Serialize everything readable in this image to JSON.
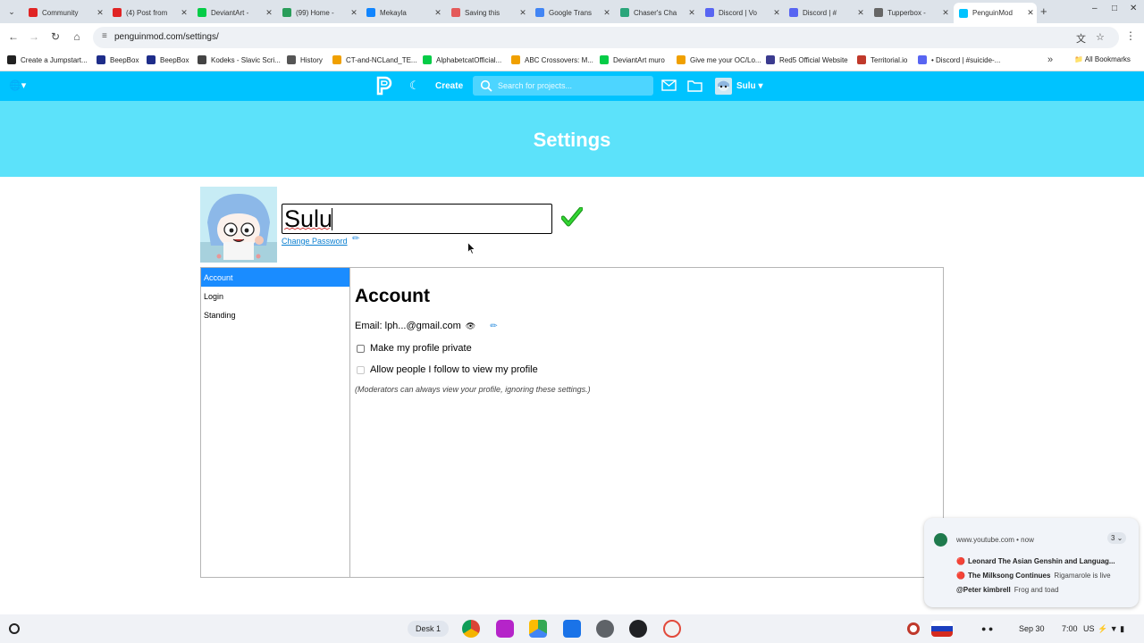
{
  "browser": {
    "tabs": [
      {
        "label": "Community",
        "color": "#e02424"
      },
      {
        "label": "(4) Post from",
        "color": "#e02424"
      },
      {
        "label": "DeviantArt -",
        "color": "#05cc47"
      },
      {
        "label": "(99) Home -",
        "color": "#2a9d5a"
      },
      {
        "label": "Mekayla",
        "color": "#1185fe"
      },
      {
        "label": "Saving this",
        "color": "#e45a5a"
      },
      {
        "label": "Google Trans",
        "color": "#4285f4"
      },
      {
        "label": "Chaser's Cha",
        "color": "#2aa57a"
      },
      {
        "label": "Discord | Vo",
        "color": "#5865f2"
      },
      {
        "label": "Discord | #",
        "color": "#5865f2"
      },
      {
        "label": "Tupperbox -",
        "color": "#666666"
      },
      {
        "label": "PenguinMod",
        "color": "#00c3ff"
      }
    ],
    "url": "penguinmod.com/settings/",
    "bookmarks": [
      {
        "label": "Create a Jumpstart...",
        "color": "#222222"
      },
      {
        "label": "BeepBox",
        "color": "#1e2d8a"
      },
      {
        "label": "BeepBox",
        "color": "#1e2d8a"
      },
      {
        "label": "Kodeks - Slavic Scri...",
        "color": "#444444"
      },
      {
        "label": "History",
        "color": "#555555"
      },
      {
        "label": "CT-and-NCLand_TE...",
        "color": "#f0a000"
      },
      {
        "label": "AlphabetcatOfficial...",
        "color": "#05cc47"
      },
      {
        "label": "ABC Crossovers: M...",
        "color": "#f0a000"
      },
      {
        "label": "DeviantArt muro",
        "color": "#05cc47"
      },
      {
        "label": "Give me your OC/Lo...",
        "color": "#f0a000"
      },
      {
        "label": "Red5 Official Website",
        "color": "#3b3b8f"
      },
      {
        "label": "Territorial.io",
        "color": "#c0392b"
      },
      {
        "label": "• Discord | #suicide-...",
        "color": "#5865f2"
      }
    ],
    "all_bookmarks": "All Bookmarks"
  },
  "site": {
    "create_label": "Create",
    "search_placeholder": "Search for projects...",
    "username": "Sulu",
    "accent": "#00c3ff",
    "banner_color": "#5ce2fa"
  },
  "page": {
    "title": "Settings",
    "name_value": "Sulu",
    "change_password": "Change Password"
  },
  "settings": {
    "menu": [
      "Account",
      "Login",
      "Standing"
    ],
    "active_menu": "Account",
    "panel_title": "Account",
    "email_label": "Email:",
    "email_value": "lph...@gmail.com",
    "option_private": "Make my profile private",
    "option_follow": "Allow people I follow to view my profile",
    "note": "(Moderators can always view your profile, ignoring these settings.)"
  },
  "notification": {
    "source": "www.youtube.com • now",
    "count": "3",
    "items": [
      {
        "title": "Leonard The Asian Genshin and Languag...",
        "sub": "",
        "live": true
      },
      {
        "title": "The Milksong Continues",
        "sub": "Rigamarole is live",
        "live": true
      },
      {
        "title": "@Peter kimbrell",
        "sub": "Frog and toad",
        "live": false
      }
    ]
  },
  "shelf": {
    "desk": "Desk 1",
    "date": "Sep 30",
    "time": "7:00",
    "locale": "US"
  }
}
